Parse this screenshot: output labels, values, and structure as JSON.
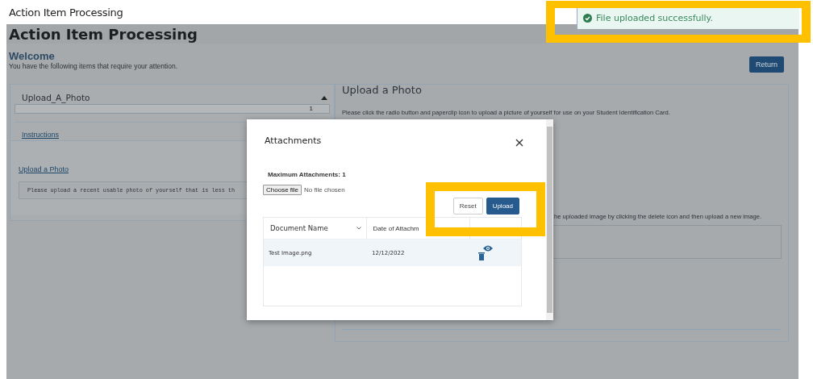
{
  "page_title": "Action Item Processing",
  "header": {
    "title": "Action Item Processing",
    "welcome": "Welcome",
    "subtitle": "You have the following items that require your attention.",
    "return_button": "Return"
  },
  "item_panel": {
    "title": "Upload_A_Photo",
    "expanded": true,
    "counter": "1",
    "instructions_link": "Instructions",
    "upload_link": "Upload a Photo",
    "note": "Please upload a recent usable photo of yourself that is less th"
  },
  "detail_panel": {
    "title": "Upload a Photo",
    "text": "Please click the radio button and paperclip icon to upload a picture of yourself for use on your Student Identification Card.",
    "text_2": "he uploaded image by clicking the delete icon and then upload a new image."
  },
  "modal": {
    "title": "Attachments",
    "max_attachments": "Maximum Attachments: 1",
    "choose_file": "Choose file",
    "file_status": "No file chosen",
    "buttons": [
      {
        "label": "Reset",
        "kind": "secondary"
      },
      {
        "label": "Upload",
        "kind": "primary"
      }
    ],
    "columns": [
      {
        "label": "Document Name",
        "sort_icon": true
      },
      {
        "label": "Date of Attachm",
        "sort_icon": false
      }
    ],
    "rows": [
      {
        "document_name": "Test Image.png",
        "date": "12/12/2022"
      }
    ]
  },
  "toast": {
    "kind": "success",
    "message": "File uploaded successfully."
  }
}
